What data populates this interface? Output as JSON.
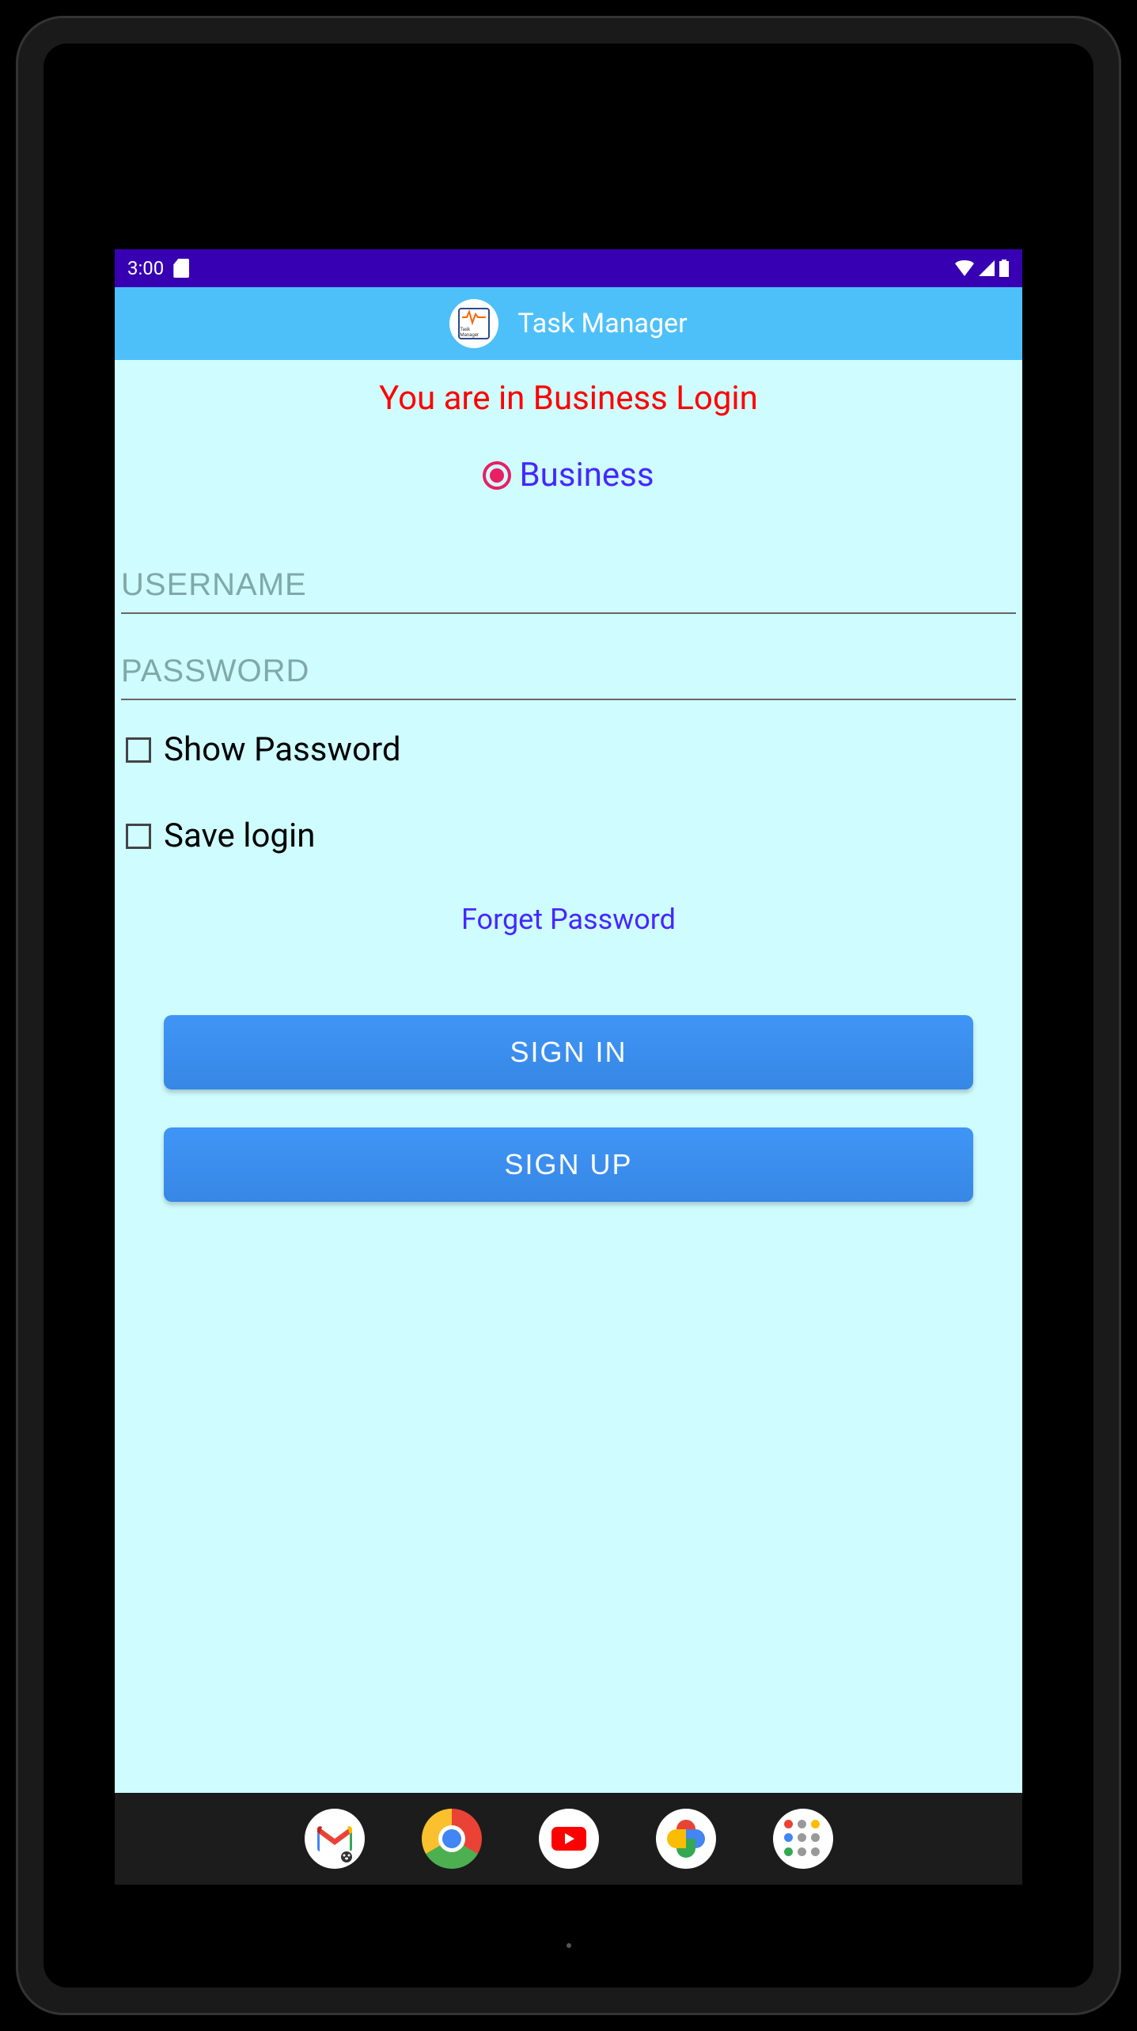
{
  "statusBar": {
    "time": "3:00"
  },
  "appBar": {
    "title": "Task Manager",
    "logoText": "Task Manager"
  },
  "content": {
    "heading": "You are in Business Login",
    "radio": {
      "label": "Business"
    },
    "usernameField": {
      "placeholder": "USERNAME",
      "value": ""
    },
    "passwordField": {
      "placeholder": "PASSWORD",
      "value": ""
    },
    "showPasswordCheckbox": {
      "label": "Show Password"
    },
    "saveLoginCheckbox": {
      "label": "Save login"
    },
    "forgetPasswordLink": "Forget Password",
    "signInButton": "SIGN IN",
    "signUpButton": "SIGN UP"
  },
  "navBar": {
    "icons": [
      "gmail",
      "chrome",
      "youtube",
      "photos",
      "apps"
    ]
  }
}
